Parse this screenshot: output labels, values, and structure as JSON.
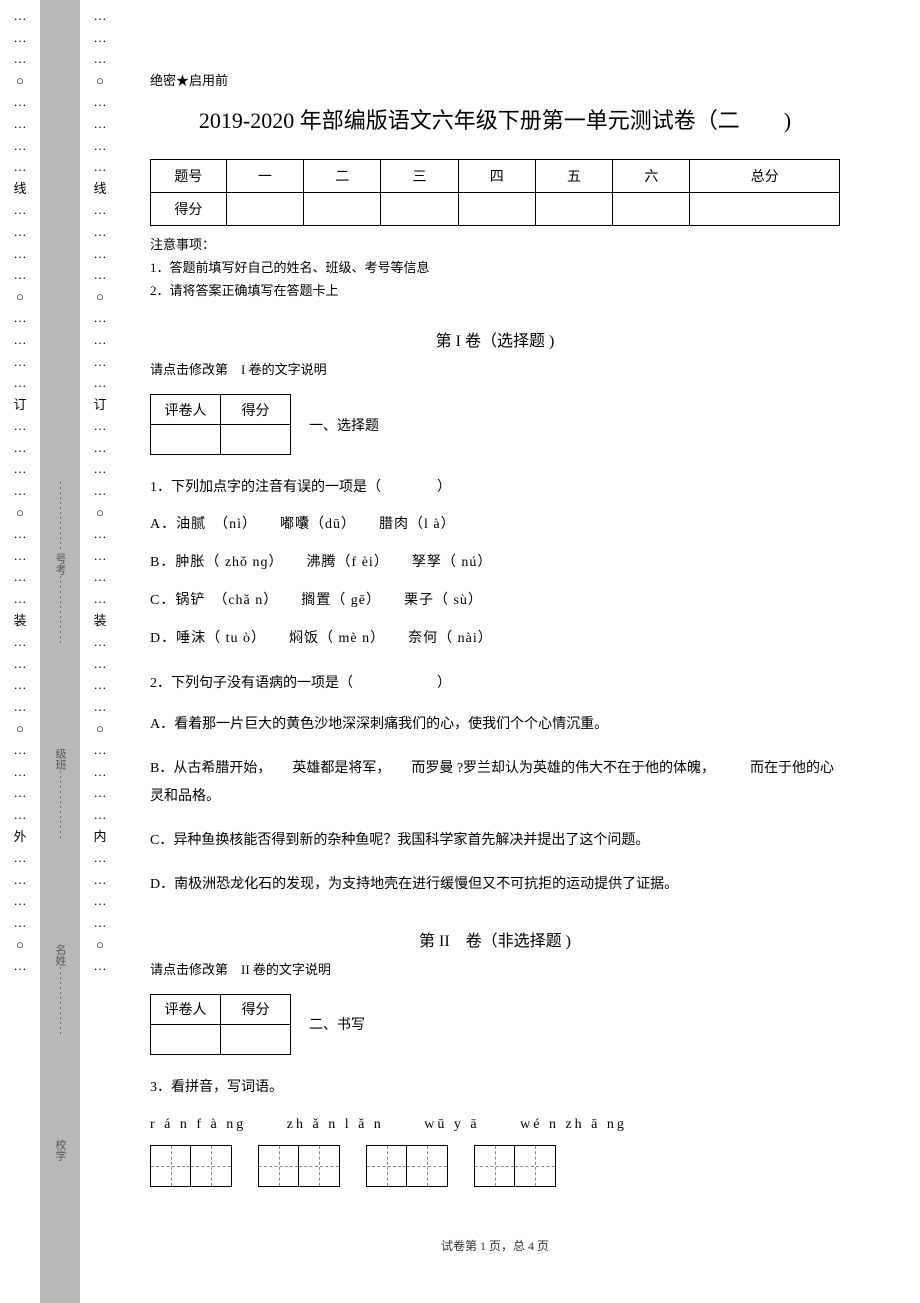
{
  "binding": {
    "left_markers": [
      "…",
      "…",
      "…",
      "○",
      "…",
      "…",
      "…",
      "…",
      "线",
      "…",
      "…",
      "…",
      "…",
      "○",
      "…",
      "…",
      "…",
      "…",
      "订",
      "…",
      "…",
      "…",
      "…",
      "○",
      "…",
      "…",
      "…",
      "…",
      "装",
      "…",
      "…",
      "…",
      "…",
      "○",
      "…",
      "…",
      "…",
      "…",
      "外",
      "…",
      "…",
      "…",
      "…",
      "○",
      "…"
    ],
    "spine_fields": [
      "号考",
      "级班",
      "名姓",
      "校学"
    ],
    "right_markers": [
      "…",
      "…",
      "…",
      "○",
      "…",
      "…",
      "…",
      "…",
      "线",
      "…",
      "…",
      "…",
      "…",
      "○",
      "…",
      "…",
      "…",
      "…",
      "订",
      "…",
      "…",
      "…",
      "…",
      "○",
      "…",
      "…",
      "…",
      "…",
      "装",
      "…",
      "…",
      "…",
      "…",
      "○",
      "…",
      "…",
      "…",
      "…",
      "内",
      "…",
      "…",
      "…",
      "…",
      "○",
      "…"
    ]
  },
  "header": {
    "secret": "绝密★启用前",
    "title": "2019-2020 年部编版语文六年级下册第一单元测试卷（二　　)"
  },
  "score_table": {
    "row_label": "题号",
    "cols": [
      "一",
      "二",
      "三",
      "四",
      "五",
      "六",
      "总分"
    ],
    "score_label": "得分"
  },
  "notice": {
    "heading": "注意事项：",
    "items": [
      "1．答题前填写好自己的姓名、班级、考号等信息",
      "2．请将答案正确填写在答题卡上"
    ]
  },
  "part1": {
    "title": "第 I 卷（选择题 )",
    "desc": "请点击修改第　I 卷的文字说明",
    "grader": {
      "c1": "评卷人",
      "c2": "得分"
    },
    "section": "一、选择题"
  },
  "q1": {
    "stem": "1．下列加点字的注音有误的一项是（　　　　）",
    "A": "A．油腻　（nì）　　嘟囔（dū）　　腊肉（l à）",
    "B": "B．肿胀（ zhǒ nɡ）　　沸腾（f èi）　　孥孥（ nú）",
    "C": "C．锅铲　（chǎ n）　　搁置（ gē）　　栗子（ sù）",
    "D": "D．唾沫（ tu ò）　　焖饭（ mè n）　　奈何（ nài）"
  },
  "q2": {
    "stem": "2．下列句子没有语病的一项是（　　　　　　）",
    "A": "A．看着那一片巨大的黄色沙地深深刺痛我们的心，使我们个个心情沉重。",
    "B": "B．从古希腊开始，　　英雄都是将军，　　而罗曼 ?罗兰却认为英雄的伟大不在于他的体魄，　　　而在于他的心灵和品格。",
    "C": "C．异种鱼换核能否得到新的杂种鱼呢？我国科学家首先解决并提出了这个问题。",
    "D": "D．南极洲恐龙化石的发现，为支持地壳在进行缓慢但又不可抗拒的运动提供了证据。"
  },
  "part2": {
    "title": "第 II　卷（非选择题 )",
    "desc": "请点击修改第　II 卷的文字说明",
    "grader": {
      "c1": "评卷人",
      "c2": "得分"
    },
    "section": "二、书写"
  },
  "q3": {
    "stem": "3．看拼音，写词语。",
    "pinyin": [
      "r á n f à ng",
      "zh ǎ n l ǎ n",
      "wū y ā",
      "wé n zh ā ng"
    ],
    "cells": [
      2,
      2,
      2,
      2
    ]
  },
  "footer": "试卷第 1 页，总 4 页"
}
